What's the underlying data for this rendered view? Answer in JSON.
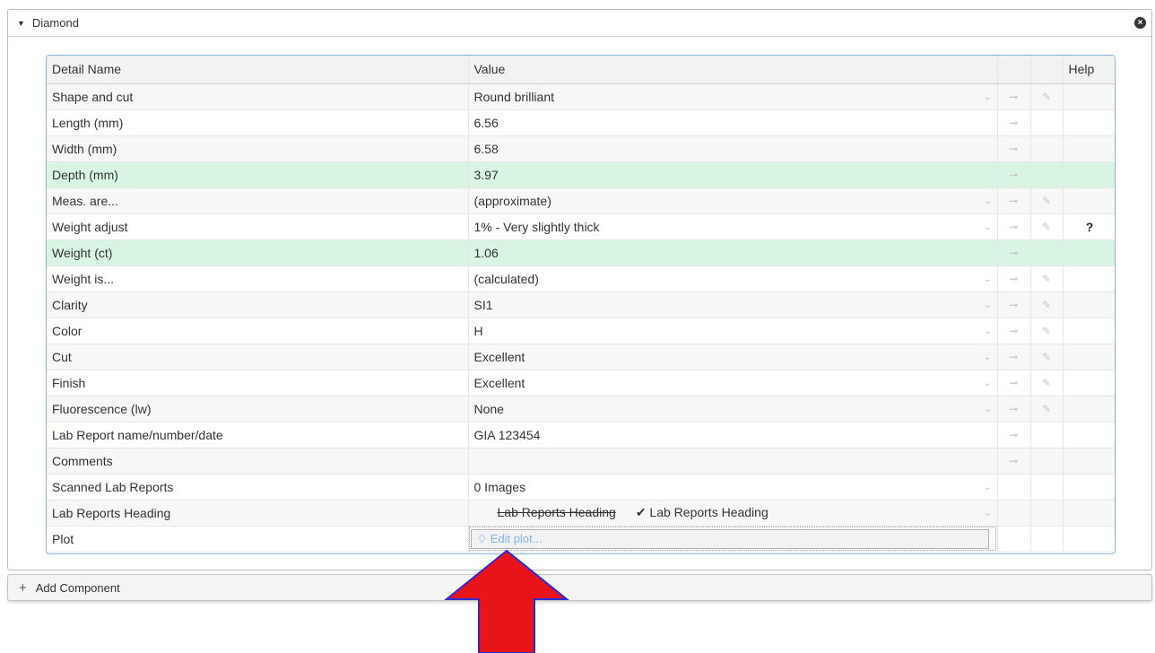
{
  "panel": {
    "title": "Diamond",
    "close_icon": "close-circle-icon"
  },
  "table": {
    "headers": {
      "name": "Detail Name",
      "value": "Value",
      "col3": "",
      "col4": "",
      "help": "Help"
    },
    "rows": [
      {
        "name": "Shape and cut",
        "value": "Round brilliant"
      },
      {
        "name": "Length (mm)",
        "value": "6.56"
      },
      {
        "name": "Width (mm)",
        "value": "6.58"
      },
      {
        "name": "Depth (mm)",
        "value": "3.97"
      },
      {
        "name": "Meas. are...",
        "value": "(approximate)"
      },
      {
        "name": "Weight adjust",
        "value": "1% - Very slightly thick",
        "help": "?"
      },
      {
        "name": "Weight (ct)",
        "value": "1.06"
      },
      {
        "name": "Weight is...",
        "value": "(calculated)"
      },
      {
        "name": "Clarity",
        "value": "SI1"
      },
      {
        "name": "Color",
        "value": "H"
      },
      {
        "name": "Cut",
        "value": "Excellent"
      },
      {
        "name": "Finish",
        "value": "Excellent"
      },
      {
        "name": "Fluorescence (lw)",
        "value": "None"
      },
      {
        "name": "Lab Report name/number/date",
        "value": "GIA 123454"
      },
      {
        "name": "Comments",
        "value": ""
      },
      {
        "name": "Scanned Lab Reports",
        "value": "0 Images"
      },
      {
        "name": "Lab Reports Heading",
        "value_strike": "Lab Reports Heading",
        "value_checked": "✔ Lab Reports Heading"
      },
      {
        "name": "Plot",
        "button": "Edit plot..."
      }
    ]
  },
  "footer": {
    "add_component": "Add Component"
  },
  "colors": {
    "highlight": "#d8f5e3",
    "arrow": "#e8141a",
    "border": "#8ab4e0"
  }
}
